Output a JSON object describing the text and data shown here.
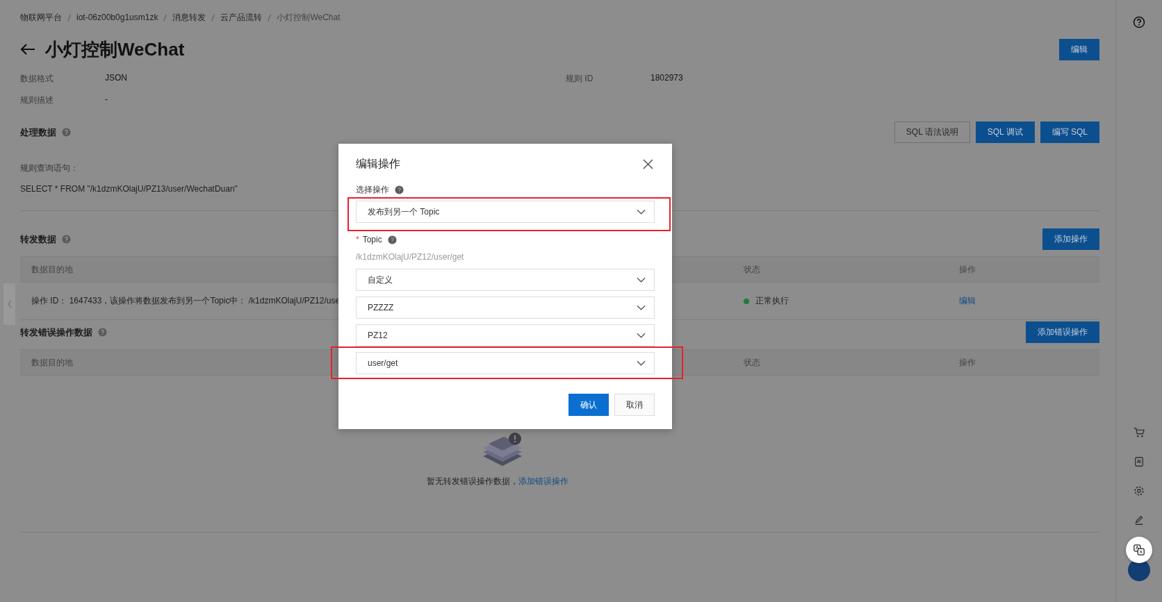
{
  "breadcrumb": [
    "物联网平台",
    "iot-06z00b0g1usm1zk",
    "消息转发",
    "云产品流转",
    "小灯控制WeChat"
  ],
  "title": "小灯控制WeChat",
  "edit_button": "编辑",
  "info": [
    {
      "label": "数据格式",
      "value": "JSON"
    },
    {
      "label": "规则 ID",
      "value": "1802973"
    },
    {
      "label": "规则描述",
      "value": "-"
    }
  ],
  "process_section": {
    "title": "处理数据",
    "buttons": [
      {
        "label": "SQL 语法说明",
        "primary": false
      },
      {
        "label": "SQL 调试",
        "primary": true
      },
      {
        "label": "编写 SQL",
        "primary": true
      }
    ],
    "query_label": "规则查询语句：",
    "query": "SELECT * FROM \"/k1dzmKOlajU/PZ13/user/WechatDuan\""
  },
  "forward_section": {
    "title": "转发数据",
    "button": "添加操作",
    "columns": [
      "数据目的地",
      "状态",
      "操作"
    ],
    "rows": [
      {
        "destination": "操作 ID： 1647433，该操作将数据发布到另一个Topic中： /k1dzmKOlajU/PZ12/use",
        "status": "正常执行",
        "color": "#1d7a3a",
        "action": "编辑"
      }
    ]
  },
  "error_section": {
    "title": "转发错误操作数据",
    "button": "添加错误操作",
    "columns": [
      "数据目的地",
      "状态",
      "操作"
    ],
    "empty_text": "暂无转发错误操作数据，",
    "empty_link": "添加错误操作"
  },
  "dialog": {
    "title": "编辑操作",
    "operation_label": "选择操作",
    "operation": {
      "value": "发布到另一个 Topic",
      "highlighted": true
    },
    "topic_label": "Topic",
    "required_mark": "*",
    "topic_path": "/k1dzmKOlajU/PZ12/user/get",
    "selects": [
      {
        "value": "自定义",
        "highlighted": false
      },
      {
        "value": "PZZZZ",
        "highlighted": false
      },
      {
        "value": "PZ12",
        "highlighted": false
      },
      {
        "value": "user/get",
        "highlighted": true
      }
    ],
    "buttons": [
      {
        "label": "确认",
        "primary": true
      },
      {
        "label": "取消",
        "primary": false
      }
    ]
  }
}
